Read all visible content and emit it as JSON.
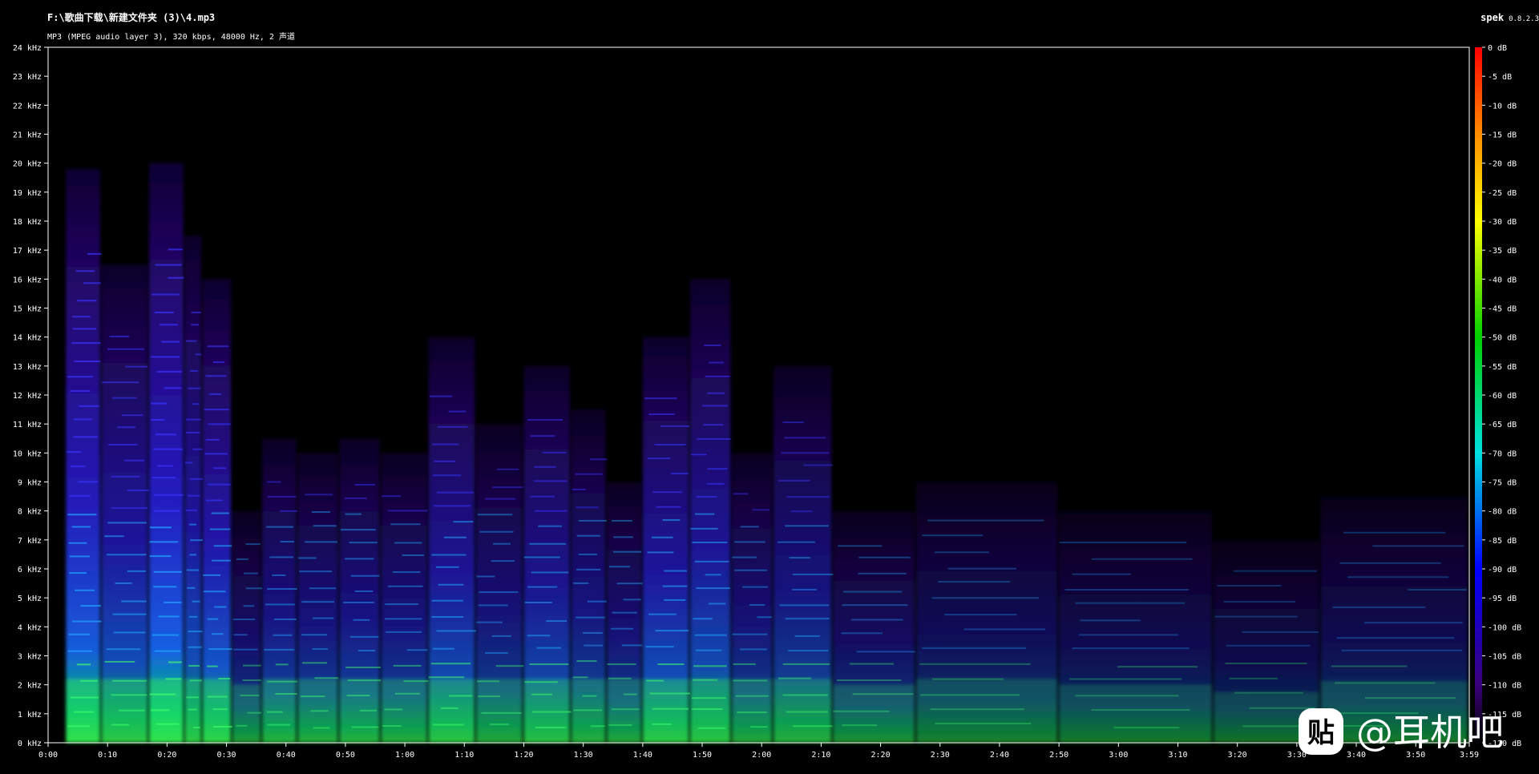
{
  "header": {
    "file_path": "F:\\歌曲下载\\新建文件夹 (3)\\4.mp3",
    "file_info": "MP3 (MPEG audio layer 3), 320 kbps, 48000 Hz, 2 声道",
    "app_name": "spek",
    "app_version": "0.8.2.3"
  },
  "watermark": {
    "icon": "tieba-paste-icon",
    "icon_glyph": "贴",
    "text": "@耳机吧"
  },
  "colors": {
    "background": "#000000",
    "frame": "#ffffff",
    "scale_top": "#ff0000",
    "scale_bottom": "#000000"
  },
  "chart_data": {
    "type": "heatmap",
    "title": "F:\\歌曲下载\\新建文件夹 (3)\\4.mp3",
    "subtitle": "MP3 (MPEG audio layer 3), 320 kbps, 48000 Hz, 2 声道",
    "x_unit": "seconds",
    "xlim": [
      0,
      239
    ],
    "x_ticks": [
      "0:00",
      "0:10",
      "0:20",
      "0:30",
      "0:40",
      "0:50",
      "1:00",
      "1:10",
      "1:20",
      "1:30",
      "1:40",
      "1:50",
      "2:00",
      "2:10",
      "2:20",
      "2:30",
      "2:40",
      "2:50",
      "3:00",
      "3:10",
      "3:20",
      "3:30",
      "3:40",
      "3:50",
      "3:59"
    ],
    "y_unit": "kHz",
    "ylim": [
      0,
      24
    ],
    "y_ticks": [
      "0 kHz",
      "1 kHz",
      "2 kHz",
      "3 kHz",
      "4 kHz",
      "5 kHz",
      "6 kHz",
      "7 kHz",
      "8 kHz",
      "9 kHz",
      "10 kHz",
      "11 kHz",
      "12 kHz",
      "13 kHz",
      "14 kHz",
      "15 kHz",
      "16 kHz",
      "17 kHz",
      "18 kHz",
      "19 kHz",
      "20 kHz",
      "21 kHz",
      "22 kHz",
      "23 kHz",
      "24 kHz"
    ],
    "color_scale": {
      "range_db": [
        -120,
        0
      ],
      "ticks": [
        "0 dB",
        "-5 dB",
        "-10 dB",
        "-15 dB",
        "-20 dB",
        "-25 dB",
        "-30 dB",
        "-35 dB",
        "-40 dB",
        "-45 dB",
        "-50 dB",
        "-55 dB",
        "-60 dB",
        "-65 dB",
        "-70 dB",
        "-75 dB",
        "-80 dB",
        "-85 dB",
        "-90 dB",
        "-95 dB",
        "-100 dB",
        "-105 dB",
        "-110 dB",
        "-115 dB",
        "-120 dB"
      ],
      "stops": [
        {
          "db": 0,
          "color": "#ff0000"
        },
        {
          "db": -15,
          "color": "#ff8c00"
        },
        {
          "db": -30,
          "color": "#ffff00"
        },
        {
          "db": -50,
          "color": "#00d000"
        },
        {
          "db": -70,
          "color": "#00e0e0"
        },
        {
          "db": -90,
          "color": "#0000ff"
        },
        {
          "db": -110,
          "color": "#3a007a"
        },
        {
          "db": -120,
          "color": "#000000"
        }
      ]
    },
    "segments": [
      {
        "start": 3,
        "end": 9,
        "cutoff_khz": 19.8,
        "level_db": -60
      },
      {
        "start": 9,
        "end": 17,
        "cutoff_khz": 16.5,
        "level_db": -70
      },
      {
        "start": 17,
        "end": 23,
        "cutoff_khz": 20.0,
        "level_db": -58
      },
      {
        "start": 23,
        "end": 26,
        "cutoff_khz": 17.5,
        "level_db": -70
      },
      {
        "start": 26,
        "end": 31,
        "cutoff_khz": 16.0,
        "level_db": -65
      },
      {
        "start": 31,
        "end": 36,
        "cutoff_khz": 8.0,
        "level_db": -85
      },
      {
        "start": 36,
        "end": 42,
        "cutoff_khz": 10.5,
        "level_db": -78
      },
      {
        "start": 42,
        "end": 49,
        "cutoff_khz": 10.0,
        "level_db": -80
      },
      {
        "start": 49,
        "end": 56,
        "cutoff_khz": 10.5,
        "level_db": -78
      },
      {
        "start": 56,
        "end": 64,
        "cutoff_khz": 10.0,
        "level_db": -80
      },
      {
        "start": 64,
        "end": 72,
        "cutoff_khz": 14.0,
        "level_db": -72
      },
      {
        "start": 72,
        "end": 80,
        "cutoff_khz": 11.0,
        "level_db": -82
      },
      {
        "start": 80,
        "end": 88,
        "cutoff_khz": 13.0,
        "level_db": -74
      },
      {
        "start": 88,
        "end": 94,
        "cutoff_khz": 11.5,
        "level_db": -80
      },
      {
        "start": 94,
        "end": 100,
        "cutoff_khz": 9.0,
        "level_db": -82
      },
      {
        "start": 100,
        "end": 108,
        "cutoff_khz": 14.0,
        "level_db": -70
      },
      {
        "start": 108,
        "end": 115,
        "cutoff_khz": 16.0,
        "level_db": -72
      },
      {
        "start": 115,
        "end": 122,
        "cutoff_khz": 10.0,
        "level_db": -82
      },
      {
        "start": 122,
        "end": 132,
        "cutoff_khz": 13.0,
        "level_db": -80
      },
      {
        "start": 132,
        "end": 146,
        "cutoff_khz": 8.0,
        "level_db": -88
      },
      {
        "start": 146,
        "end": 170,
        "cutoff_khz": 9.0,
        "level_db": -92
      },
      {
        "start": 170,
        "end": 196,
        "cutoff_khz": 8.0,
        "level_db": -94
      },
      {
        "start": 196,
        "end": 214,
        "cutoff_khz": 7.0,
        "level_db": -96
      },
      {
        "start": 214,
        "end": 239,
        "cutoff_khz": 8.5,
        "level_db": -94
      }
    ],
    "grid": false,
    "legend": "right"
  }
}
